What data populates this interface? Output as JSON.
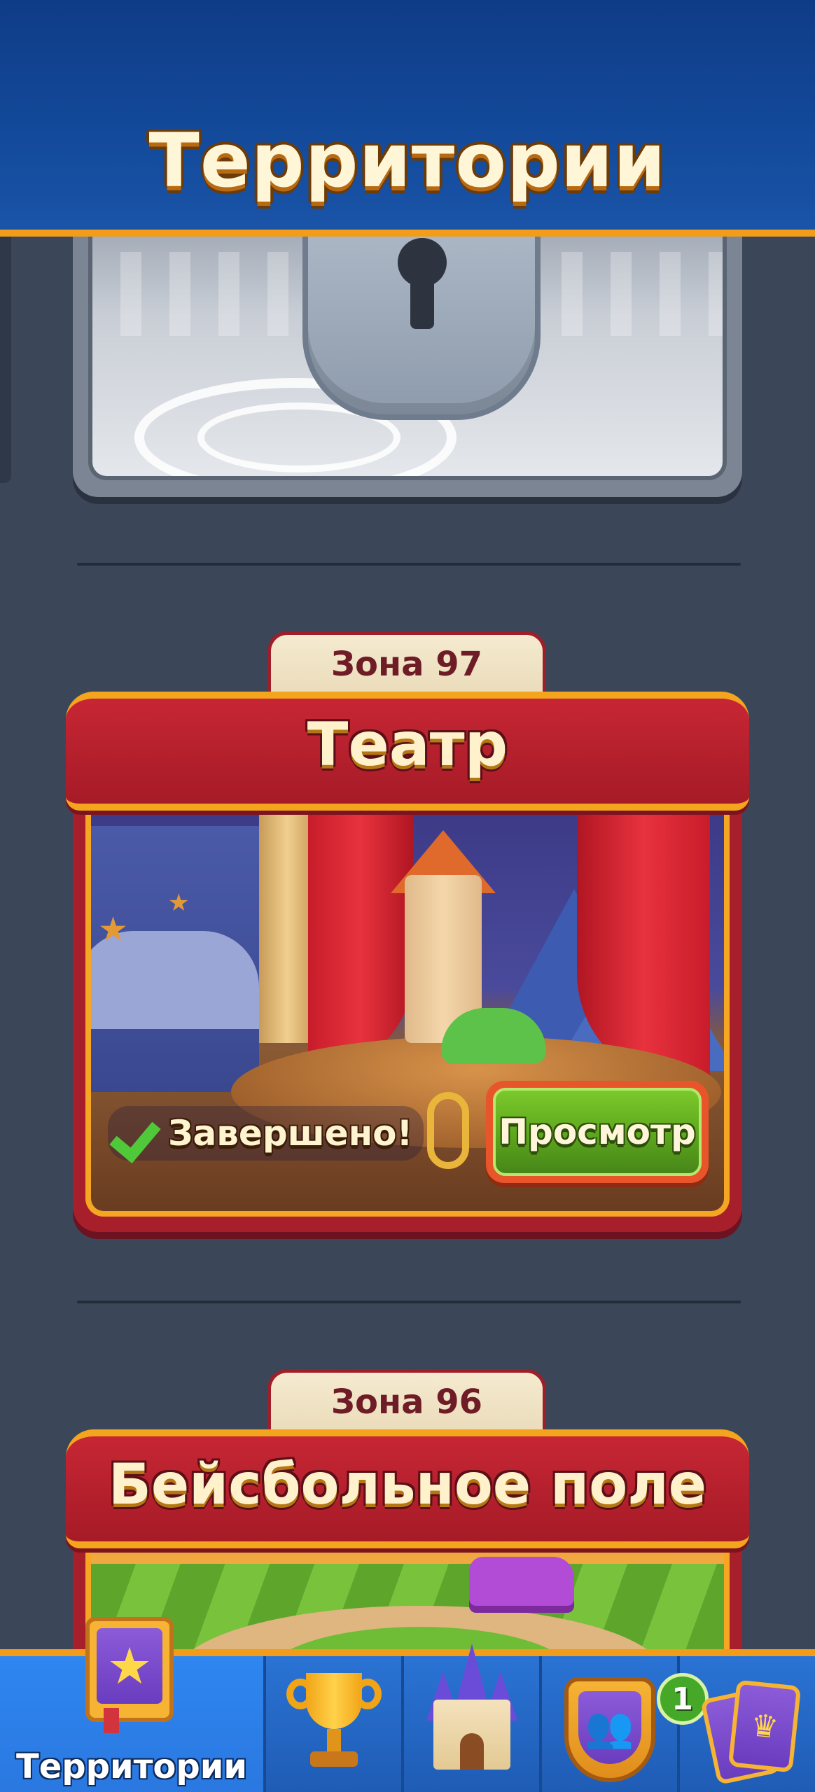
{
  "header": {
    "title": "Территории"
  },
  "zones": [
    {
      "tab_label": "Зона 97",
      "name": "Театр",
      "status_text": "Завершено!",
      "view_button_label": "Просмотр"
    },
    {
      "tab_label": "Зона 96",
      "name": "Бейсбольное поле"
    }
  ],
  "bottom_nav": {
    "items": [
      {
        "label": "Территории",
        "icon": "territory-star-icon",
        "active": true
      },
      {
        "label": "",
        "icon": "trophy-icon"
      },
      {
        "label": "",
        "icon": "castle-icon"
      },
      {
        "label": "",
        "icon": "team-icon",
        "badge": "1"
      },
      {
        "label": "",
        "icon": "cards-icon"
      }
    ]
  },
  "colors": {
    "header_bg": "#134a9b",
    "accent_orange": "#f39c1a",
    "ribbon_red": "#b31f2c",
    "button_green": "#5aa21b",
    "nav_blue": "#2a73d4",
    "page_bg": "#3b4658"
  }
}
